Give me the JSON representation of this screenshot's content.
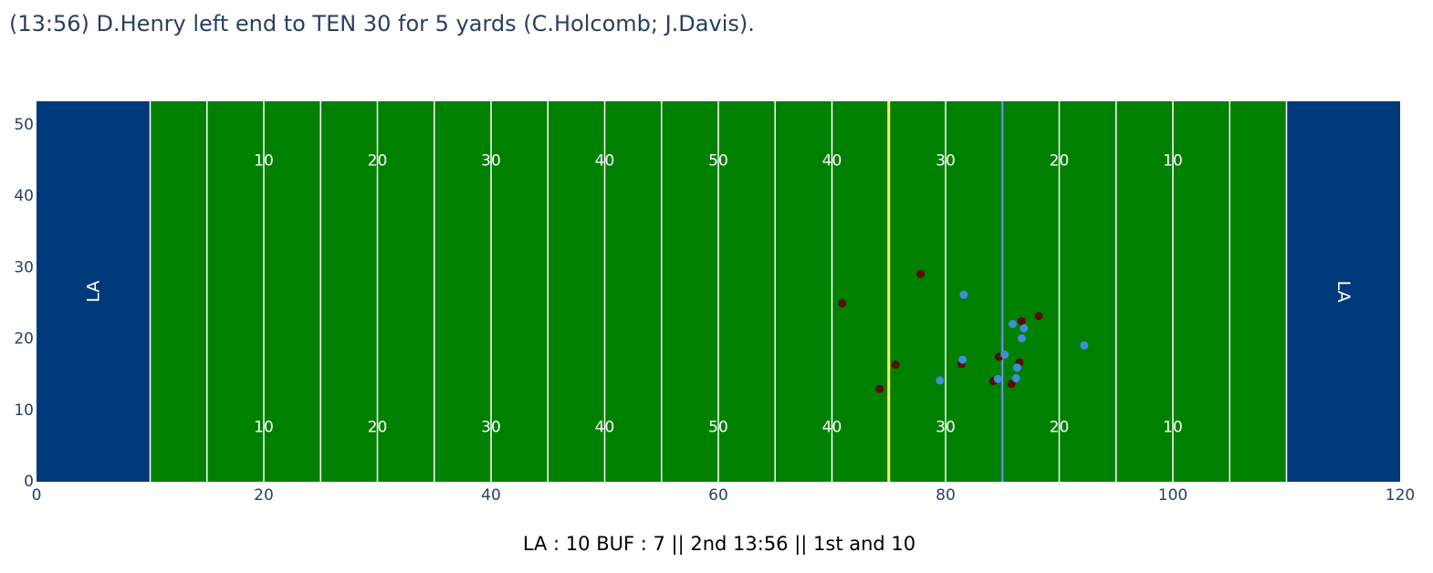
{
  "title": "(13:56) D.Henry left end to TEN 30 for 5 yards (C.Holcomb; J.Davis).",
  "caption": "LA : 10 BUF : 7 || 2nd 13:56 || 1st and 10",
  "chart_data": {
    "type": "scatter",
    "title": "(13:56) D.Henry left end to TEN 30 for 5 yards (C.Holcomb; J.Davis).",
    "xlim": [
      0,
      120
    ],
    "ylim": [
      0,
      53.3
    ],
    "x_ticks": [
      0,
      20,
      40,
      60,
      80,
      100,
      120
    ],
    "y_ticks": [
      0,
      10,
      20,
      30,
      40,
      50
    ],
    "grid": false,
    "field": {
      "field_color": "#008000",
      "endzone_color": "#003a7a",
      "line_color": "#ffffff",
      "endzones": [
        {
          "x_start": 0,
          "x_end": 10,
          "label": "LA"
        },
        {
          "x_start": 110,
          "x_end": 120,
          "label": "LA"
        }
      ],
      "yard_lines": [
        10,
        15,
        20,
        25,
        30,
        35,
        40,
        45,
        50,
        55,
        60,
        65,
        70,
        75,
        80,
        85,
        90,
        95,
        100,
        105,
        110
      ],
      "yard_numbers": [
        {
          "x": 20,
          "text": "10"
        },
        {
          "x": 30,
          "text": "20"
        },
        {
          "x": 40,
          "text": "30"
        },
        {
          "x": 50,
          "text": "40"
        },
        {
          "x": 60,
          "text": "50"
        },
        {
          "x": 70,
          "text": "40"
        },
        {
          "x": 80,
          "text": "30"
        },
        {
          "x": 90,
          "text": "20"
        },
        {
          "x": 100,
          "text": "10"
        }
      ],
      "yard_number_rows": [
        44.9,
        7.6
      ],
      "first_down_line": {
        "x": 75,
        "color": "#ffff66"
      },
      "line_of_scrimmage": {
        "x": 85,
        "color": "#7a8cff"
      }
    },
    "series": [
      {
        "color": "#5c0a0a",
        "points": [
          {
            "x": 70.9,
            "y": 25.0
          },
          {
            "x": 77.8,
            "y": 29.1
          },
          {
            "x": 74.2,
            "y": 13.0
          },
          {
            "x": 75.6,
            "y": 16.4
          },
          {
            "x": 81.4,
            "y": 16.5
          },
          {
            "x": 84.2,
            "y": 14.1
          },
          {
            "x": 84.7,
            "y": 17.5
          },
          {
            "x": 85.8,
            "y": 13.7
          },
          {
            "x": 86.5,
            "y": 16.7
          },
          {
            "x": 86.7,
            "y": 22.5
          },
          {
            "x": 88.2,
            "y": 23.2
          }
        ]
      },
      {
        "color": "#3d8fd9",
        "points": [
          {
            "x": 79.5,
            "y": 14.2
          },
          {
            "x": 81.5,
            "y": 17.1
          },
          {
            "x": 81.6,
            "y": 26.2
          },
          {
            "x": 84.6,
            "y": 14.4
          },
          {
            "x": 85.2,
            "y": 17.8
          },
          {
            "x": 85.9,
            "y": 22.1
          },
          {
            "x": 86.2,
            "y": 14.5
          },
          {
            "x": 86.3,
            "y": 16.0
          },
          {
            "x": 86.7,
            "y": 20.1
          },
          {
            "x": 86.9,
            "y": 21.5
          },
          {
            "x": 92.2,
            "y": 19.1
          }
        ]
      }
    ]
  }
}
